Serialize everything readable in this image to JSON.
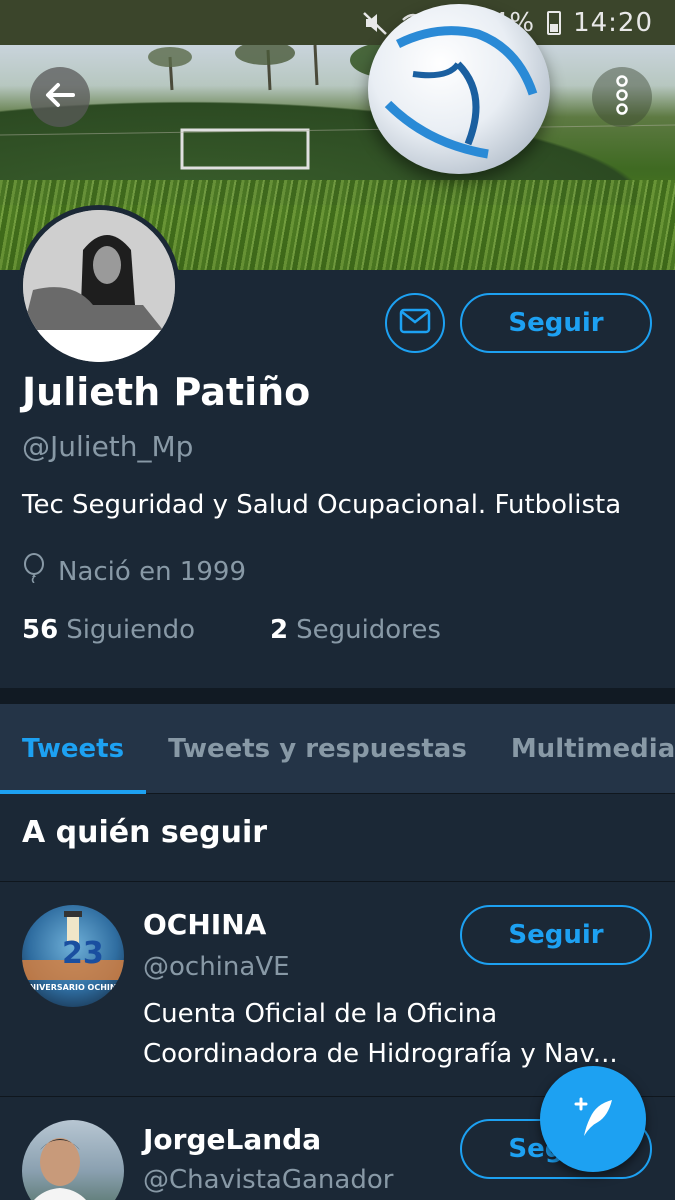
{
  "status_bar": {
    "battery_percent": "34%",
    "time": "14:20",
    "icons": [
      "mute-icon",
      "wifi-icon",
      "signal-icon",
      "battery-icon"
    ]
  },
  "header": {
    "back_icon": "back-arrow-icon",
    "more_icon": "more-vertical-icon"
  },
  "profile": {
    "name": "Julieth Patiño",
    "handle": "@Julieth_Mp",
    "bio": "Tec Seguridad y Salud Ocupacional. Futbolista",
    "birth": "Nació en 1999",
    "following_count": "56",
    "following_label": "Siguiendo",
    "followers_count": "2",
    "followers_label": "Seguidores",
    "follow_label": "Seguir"
  },
  "tabs": [
    {
      "label": "Tweets",
      "active": true
    },
    {
      "label": "Tweets y respuestas",
      "active": false
    },
    {
      "label": "Multimedia",
      "active": false
    }
  ],
  "who_to_follow": {
    "title": "A quién seguir",
    "items": [
      {
        "name": "OCHINA",
        "handle": "@ochinaVE",
        "bio_line1": "Cuenta Oficial de la Oficina",
        "bio_line2": "Coordinadora de Hidrografía y Nav...",
        "follow_label": "Seguir",
        "avatar_text_top": "23",
        "avatar_text_bottom": "ANIVERSARIO OCHINA"
      },
      {
        "name": "JorgeLanda",
        "handle": "@ChavistaGanador",
        "follow_label": "Seguir"
      }
    ]
  },
  "colors": {
    "background": "#1b2836",
    "accent": "#1da1f2",
    "secondary_text": "#8899a6",
    "status_bar": "#3b452b"
  }
}
